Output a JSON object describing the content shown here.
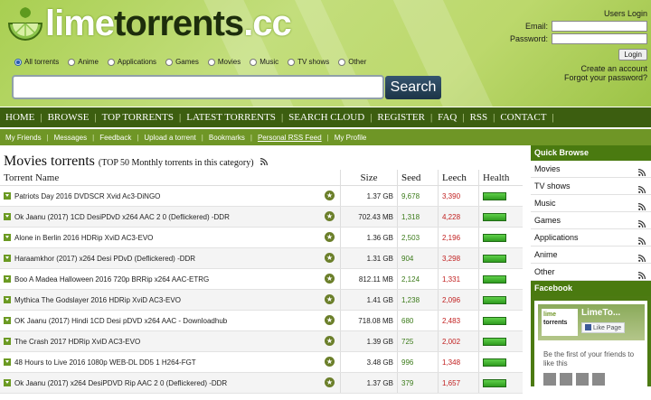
{
  "site": {
    "logo_part1": "lime",
    "logo_part2": "torrents",
    "logo_part3": ".cc"
  },
  "login": {
    "title": "Users Login",
    "email_label": "Email:",
    "password_label": "Password:",
    "button": "Login",
    "create_account": "Create an account",
    "forgot_password": "Forgot your password?"
  },
  "categories": [
    {
      "label": "All torrents",
      "selected": true
    },
    {
      "label": "Anime",
      "selected": false
    },
    {
      "label": "Applications",
      "selected": false
    },
    {
      "label": "Games",
      "selected": false
    },
    {
      "label": "Movies",
      "selected": false
    },
    {
      "label": "Music",
      "selected": false
    },
    {
      "label": "TV shows",
      "selected": false
    },
    {
      "label": "Other",
      "selected": false
    }
  ],
  "search": {
    "value": "",
    "button": "Search"
  },
  "nav": [
    "HOME",
    "BROWSE",
    "TOP TORRENTS",
    "LATEST TORRENTS",
    "SEARCH CLOUD",
    "REGISTER",
    "FAQ",
    "RSS",
    "CONTACT"
  ],
  "subnav": [
    "My Friends",
    "Messages",
    "Feedback",
    "Upload a torrent",
    "Bookmarks",
    "Personal RSS Feed",
    "My Profile"
  ],
  "main": {
    "title": "Movies torrents",
    "subtitle": "(TOP 50 Monthly torrents in this category)",
    "columns": {
      "name": "Torrent Name",
      "size": "Size",
      "seed": "Seed",
      "leech": "Leech",
      "health": "Health"
    },
    "torrents": [
      {
        "name": "Patriots Day 2016 DVDSCR Xvid Ac3-DiNGO",
        "size": "1.37 GB",
        "seed": "9,678",
        "leech": "3,390"
      },
      {
        "name": "Ok Jaanu (2017) 1CD DesiPDvD x264 AAC 2 0 (Deflickered) -DDR",
        "size": "702.43 MB",
        "seed": "1,318",
        "leech": "4,228"
      },
      {
        "name": "Alone in Berlin 2016 HDRip XviD AC3-EVO",
        "size": "1.36 GB",
        "seed": "2,503",
        "leech": "2,196"
      },
      {
        "name": "Haraamkhor (2017) x264 Desi PDvD (Deflickered) -DDR",
        "size": "1.31 GB",
        "seed": "904",
        "leech": "3,298"
      },
      {
        "name": "Boo A Madea Halloween 2016 720p BRRip x264 AAC-ETRG",
        "size": "812.11 MB",
        "seed": "2,124",
        "leech": "1,331"
      },
      {
        "name": "Mythica The Godslayer 2016 HDRip XviD AC3-EVO",
        "size": "1.41 GB",
        "seed": "1,238",
        "leech": "2,096"
      },
      {
        "name": "OK Jaanu (2017) Hindi 1CD Desi pDVD x264 AAC - Downloadhub",
        "size": "718.08 MB",
        "seed": "680",
        "leech": "2,483"
      },
      {
        "name": "The Crash 2017 HDRip XviD AC3-EVO",
        "size": "1.39 GB",
        "seed": "725",
        "leech": "2,002"
      },
      {
        "name": "48 Hours to Live 2016 1080p WEB-DL DD5 1 H264-FGT",
        "size": "3.48 GB",
        "seed": "996",
        "leech": "1,348"
      },
      {
        "name": "Ok Jaanu (2017) x264 DesiPDVD Rip AAC 2 0 (Deflickered) -DDR",
        "size": "1.37 GB",
        "seed": "379",
        "leech": "1,657"
      }
    ]
  },
  "sidebar": {
    "title": "Quick Browse",
    "items": [
      "Movies",
      "TV shows",
      "Music",
      "Games",
      "Applications",
      "Anime",
      "Other"
    ],
    "facebook_title": "Facebook",
    "fb_page_name": "LimeTo...",
    "fb_logo_text1": "lime",
    "fb_logo_text2": "torrents",
    "fb_like": "Like Page",
    "fb_text": "Be the first of your friends to like this"
  },
  "colors": {
    "nav_bg": "#3c5e10",
    "subnav_bg": "#6f9626",
    "seed": "#3a7a18",
    "leech": "#c11e1e",
    "sidebar_bg": "#4c7a12"
  }
}
